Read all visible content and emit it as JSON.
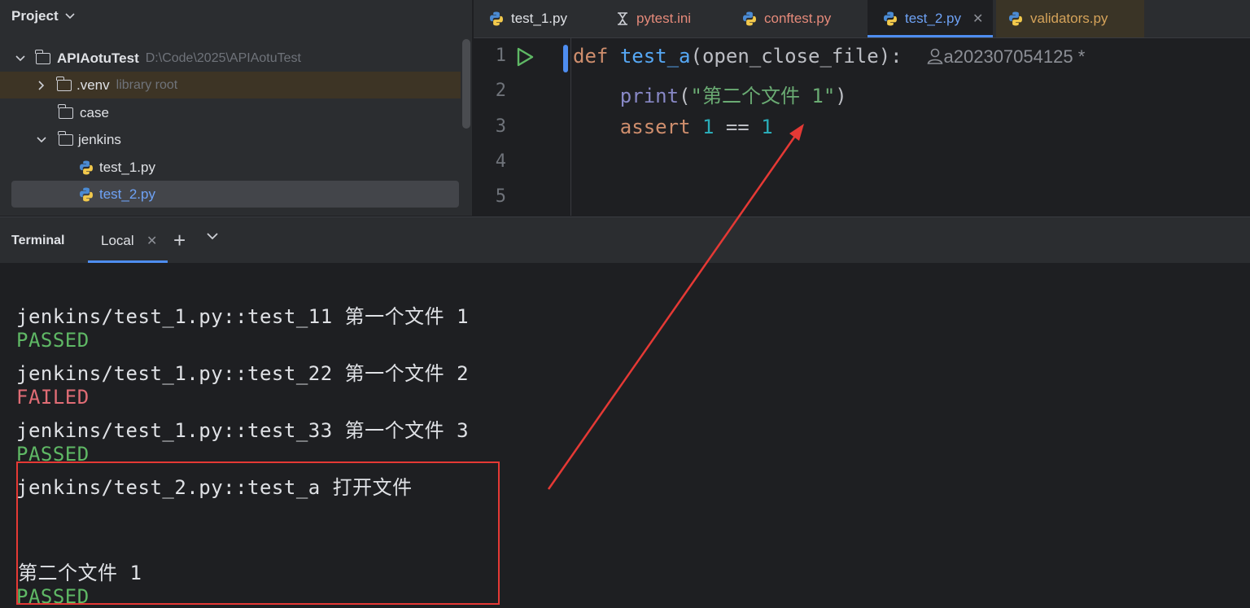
{
  "project": {
    "header": "Project",
    "rows": [
      {
        "label": "APIAotuTest",
        "hint": "D:\\Code\\2025\\APIAotuTest"
      },
      {
        "label": ".venv",
        "hint": "library root"
      },
      {
        "label": "case"
      },
      {
        "label": "jenkins"
      },
      {
        "label": "test_1.py"
      },
      {
        "label": "test_2.py"
      }
    ]
  },
  "tabs": [
    {
      "label": "test_1.py",
      "color": "#dfe1e5"
    },
    {
      "label": "pytest.ini",
      "color": "#e58a7a"
    },
    {
      "label": "conftest.py",
      "color": "#e58a7a"
    },
    {
      "label": "test_2.py",
      "color": "#6ea2f5"
    },
    {
      "label": "validators.py",
      "color": "#d5a35a"
    }
  ],
  "editor": {
    "line_numbers": [
      "1",
      "2",
      "3",
      "4",
      "5"
    ],
    "code": {
      "l1_def": "def",
      "l1_name": "test_a",
      "l1_params": "(open_close_file):",
      "l1_author": "a202307054125 *",
      "l2_print": "print",
      "l2_open": "(",
      "l2_str": "\"第二个文件 1\"",
      "l2_close": ")",
      "l3_assert": "assert",
      "l3_a": "1",
      "l3_op": "==",
      "l3_b": "1"
    }
  },
  "terminal": {
    "title": "Terminal",
    "tab_label": "Local",
    "lines": [
      "jenkins/test_1.py::test_11 第一个文件 1",
      "PASSED",
      "jenkins/test_1.py::test_22 第一个文件 2",
      "FAILED",
      "jenkins/test_1.py::test_33 第一个文件 3",
      "PASSED",
      "jenkins/test_2.py::test_a 打开文件",
      "第二个文件 1",
      "PASSED"
    ]
  },
  "colors": {
    "passed": "#5fb865",
    "failed": "#e06c75",
    "annotation": "#e53935",
    "accent": "#4e8df0"
  }
}
